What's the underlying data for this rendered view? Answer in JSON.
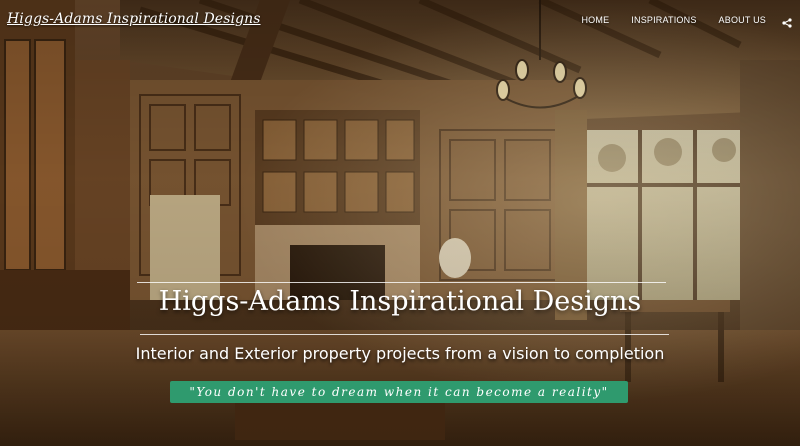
{
  "site": {
    "title": "Higgs-Adams Inspirational Designs"
  },
  "nav": {
    "items": [
      {
        "label": "HOME"
      },
      {
        "label": "INSPIRATIONS"
      },
      {
        "label": "ABOUT US"
      }
    ],
    "share_icon": "share-icon"
  },
  "hero": {
    "headline": "Higgs-Adams Inspirational Designs",
    "subline": "Interior and Exterior property projects from a vision to completion",
    "quote": "\"You don't have to dream when it can become a reality\"",
    "accent_color": "#2f9a6e"
  }
}
